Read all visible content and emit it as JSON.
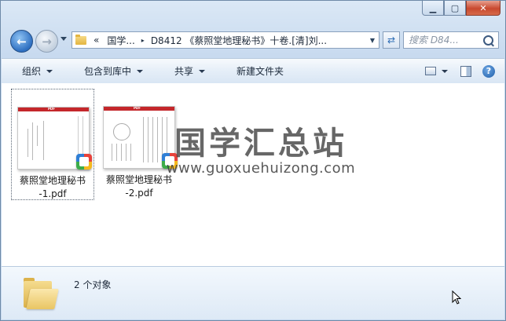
{
  "window": {
    "controls": [
      "minimize",
      "maximize",
      "close"
    ]
  },
  "nav": {
    "back_icon": "back-arrow-icon",
    "forward_icon": "forward-arrow-icon",
    "address": {
      "overflow": "«",
      "crumbs": [
        "国学...",
        "D8412 《蔡照堂地理秘书》十卷.[清]刘..."
      ],
      "separator": "▸"
    },
    "refresh_icon": "refresh-icon",
    "search_placeholder": "搜索 D84..."
  },
  "toolbar": {
    "organize": "组织",
    "include_in_library": "包含到库中",
    "share": "共享",
    "new_folder": "新建文件夹"
  },
  "files": [
    {
      "name": "蔡照堂地理秘书-1.pdf",
      "name_line1": "蔡照堂地理秘书",
      "name_line2": "-1.pdf",
      "selected": true
    },
    {
      "name": "蔡照堂地理秘书-2.pdf",
      "name_line1": "蔡照堂地理秘书",
      "name_line2": "-2.pdf",
      "selected": false
    }
  ],
  "thumbnail_banner": "PDF",
  "watermark": {
    "chinese": "国学汇总站",
    "url": "www.guoxuehuizong.com"
  },
  "status": {
    "item_count": "2 个对象"
  },
  "colors": {
    "pdf_red": "#c4272b",
    "accent_blue": "#2e6fc1"
  }
}
